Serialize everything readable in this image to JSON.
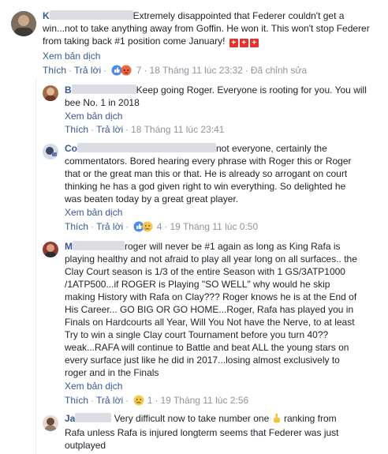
{
  "main_comment": {
    "name_initial": "K",
    "text_line1": "Extremely disappointed that Federer couldn't get a",
    "text_line2": "win...not to take anything away from Goffin. He won it. This won't stop Federer",
    "text_line3": "from taking back #1 position come January!",
    "flag_glyph": "+",
    "translate": "Xem bản dịch",
    "like": "Thích",
    "reply": "Trả lời",
    "reaction_count": "7",
    "time": "18 Tháng 11 lúc 23:32",
    "edited": "Đã chỉnh sửa"
  },
  "replies": [
    {
      "name_initial": "B",
      "lines": [
        "Keep going Roger. Everyone is rooting for you. You will",
        "bee No. 1 in 2018"
      ],
      "translate": "Xem bản dịch",
      "like": "Thích",
      "reply": "Trả lời",
      "time": "18 Tháng 11 lúc 23:41"
    },
    {
      "name_initial": "Co",
      "lines": [
        "not everyone, certainly the",
        "commentators. Bored hearing every phrase with Roger this or Roger",
        "that or the great man this or that. He is already so arrogant on court",
        "thinking he has a god given right to win everything. So delighted he",
        "was beaten today by a great great player."
      ],
      "translate": "Xem bản dịch",
      "like": "Thích",
      "reply": "Trả lời",
      "reaction_count": "4",
      "time": "19 Tháng 11 lúc 0:50"
    },
    {
      "name_initial": "M",
      "lines": [
        "roger will never be #1 again as long as King Rafa is",
        "playing healthy and not afraid to play all year long on all surfaces.. the",
        "Clay Court season is 1/3 of the entire Season with 1 GS/3ATP1000",
        "/1ATP500...if ROGER is Playing \"SO WELL\" why would he skip",
        "making History with Rafa on Clay??? Roger knows he is at the End of",
        "His Career... GO BIG OR GO HOME...Roger, Rafa has played you in",
        "Finals on Hardcourts all Year, Will You Not have the Nerve, to at least",
        "Try to win a single Clay court Tournament before you turn 40??",
        "weak...RAFA will continue to Battle and beat ALL the young stars on",
        "every surface just like he did in 2017...losing almost exclusively to",
        "roger and in the Finals"
      ],
      "translate": "Xem bản dịch",
      "like": "Thích",
      "reply": "Trả lời",
      "reaction_count": "1",
      "time": "19 Tháng 11 lúc 2:56"
    },
    {
      "name_initial": "Ja",
      "lines_a": "Very difficult now to take number one",
      "lines_b": "ranking from",
      "lines": [
        "Rafa unless Rafa is injured longterm seems that Federer was just",
        "outplayed"
      ]
    }
  ],
  "colors": {
    "link": "#385898",
    "meta": "#90949c",
    "text": "#1d2129",
    "flag": "#e5322d"
  },
  "icons": [
    "like-reaction-icon",
    "angry-reaction-icon",
    "sad-reaction-icon",
    "point-up-emoji-icon",
    "flag-icon"
  ]
}
